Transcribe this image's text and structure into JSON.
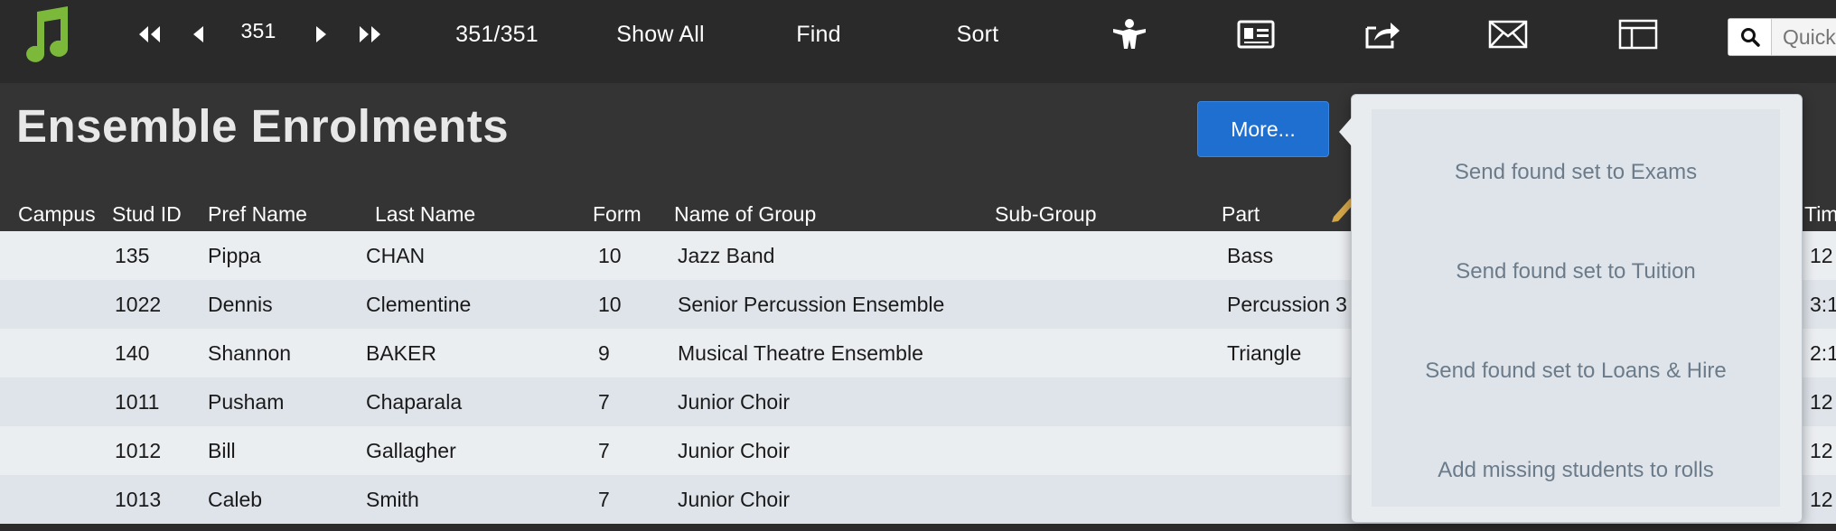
{
  "toolbar": {
    "record_number": "351",
    "record_count": "351/351",
    "show_all": "Show All",
    "find": "Find",
    "sort": "Sort",
    "quick_find_placeholder": "Quick Find"
  },
  "header": {
    "title": "Ensemble Enrolments",
    "more_button": "More..."
  },
  "columns": [
    "Campus",
    "Stud ID",
    "Pref Name",
    "Last Name",
    "Form",
    "Name of Group",
    "Sub-Group",
    "Part",
    "Tim"
  ],
  "rows": [
    {
      "campus": "",
      "stud_id": "135",
      "pref_name": "Pippa",
      "last_name": "CHAN",
      "form": "10",
      "group": "Jazz Band",
      "sub_group": "",
      "part": "Bass",
      "time": "12"
    },
    {
      "campus": "",
      "stud_id": "1022",
      "pref_name": "Dennis",
      "last_name": "Clementine",
      "form": "10",
      "group": "Senior Percussion Ensemble",
      "sub_group": "",
      "part": "Percussion 3",
      "time": "3:1"
    },
    {
      "campus": "",
      "stud_id": "140",
      "pref_name": "Shannon",
      "last_name": "BAKER",
      "form": "9",
      "group": "Musical Theatre Ensemble",
      "sub_group": "",
      "part": "Triangle",
      "time": "2:1"
    },
    {
      "campus": "",
      "stud_id": "1011",
      "pref_name": "Pusham",
      "last_name": "Chaparala",
      "form": "7",
      "group": "Junior Choir",
      "sub_group": "",
      "part": "",
      "time": "12"
    },
    {
      "campus": "",
      "stud_id": "1012",
      "pref_name": "Bill",
      "last_name": "Gallagher",
      "form": "7",
      "group": "Junior Choir",
      "sub_group": "",
      "part": "",
      "time": "12"
    },
    {
      "campus": "",
      "stud_id": "1013",
      "pref_name": "Caleb",
      "last_name": "Smith",
      "form": "7",
      "group": "Junior Choir",
      "sub_group": "",
      "part": "",
      "time": "12"
    }
  ],
  "popover": {
    "items": [
      "Send found set to Exams",
      "Send found set to Tuition",
      "Send found set to Loans & Hire",
      "Add missing students to rolls"
    ]
  },
  "colors": {
    "toolbar_bg": "#2a2a2a",
    "header_bg": "#343434",
    "accent_blue": "#1f6fd1",
    "logo_green": "#7cb93a",
    "row_light": "#ebeef1",
    "row_dark": "#dfe4ea"
  },
  "icons": [
    "music-note-icon",
    "first-record-icon",
    "prev-record-icon",
    "next-record-icon",
    "last-record-icon",
    "user-role-icon",
    "contact-card-icon",
    "share-icon",
    "envelope-icon",
    "layout-icon",
    "search-icon",
    "pencil-icon"
  ]
}
